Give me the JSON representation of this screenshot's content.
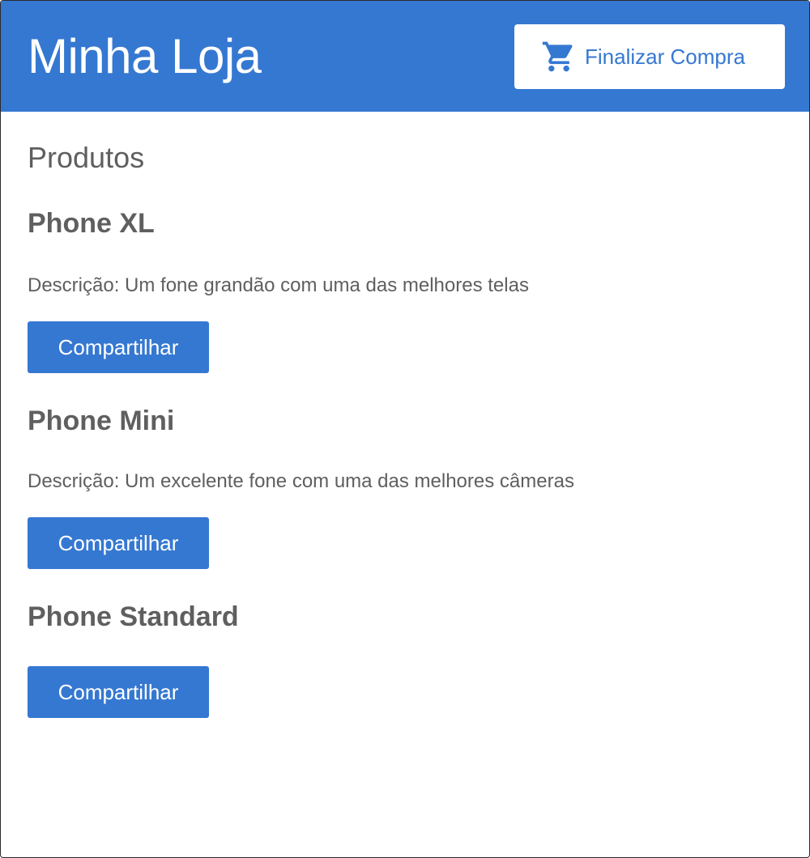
{
  "header": {
    "title": "Minha Loja",
    "checkout_label": "Finalizar Compra",
    "checkout_icon": "shopping-cart-icon"
  },
  "main": {
    "section_title": "Produtos",
    "products": [
      {
        "name": "Phone XL",
        "description": "Descrição: Um fone grandão com uma das melhores telas",
        "share_label": "Compartilhar"
      },
      {
        "name": "Phone Mini",
        "description": "Descrição: Um excelente fone com uma das melhores câmeras",
        "share_label": "Compartilhar"
      },
      {
        "name": "Phone Standard",
        "description": "",
        "share_label": "Compartilhar"
      }
    ]
  },
  "colors": {
    "primary": "#3578d1",
    "text": "#5f5f5f",
    "background": "#ffffff"
  }
}
